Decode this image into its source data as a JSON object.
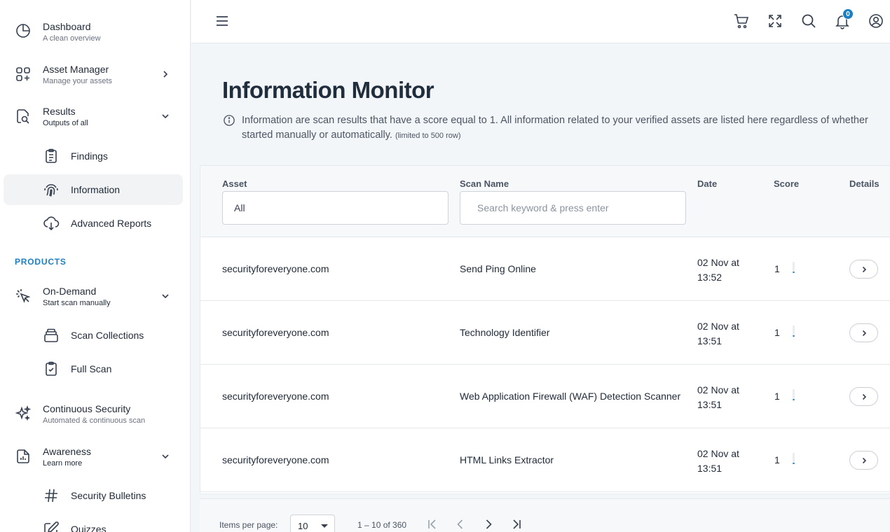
{
  "sidebar": {
    "dashboard": {
      "title": "Dashboard",
      "subtitle": "A clean overview"
    },
    "asset_manager": {
      "title": "Asset Manager",
      "subtitle": "Manage your assets"
    },
    "results": {
      "title": "Results",
      "subtitle": "Outputs of all"
    },
    "results_items": [
      {
        "label": "Findings"
      },
      {
        "label": "Information"
      },
      {
        "label": "Advanced Reports"
      }
    ],
    "products_label": "PRODUCTS",
    "on_demand": {
      "title": "On-Demand",
      "subtitle": "Start scan manually"
    },
    "on_demand_items": [
      {
        "label": "Scan Collections"
      },
      {
        "label": "Full Scan"
      }
    ],
    "continuous": {
      "title": "Continuous Security",
      "subtitle": "Automated & continuous scan"
    },
    "awareness": {
      "title": "Awareness",
      "subtitle": "Learn more"
    },
    "awareness_items": [
      {
        "label": "Security Bulletins"
      },
      {
        "label": "Quizzes"
      }
    ]
  },
  "topbar": {
    "notification_count": "0",
    "icons": [
      "menu-icon",
      "cart-icon",
      "fullscreen-icon",
      "search-icon",
      "bell-icon",
      "user-icon"
    ]
  },
  "main": {
    "title": "Information Monitor",
    "info_text": "Information are scan results that have a score equal to 1. All information related to your verified assets are listed here regardless of whether started manually or automatically.",
    "info_note": "(limited to 500 row)"
  },
  "table": {
    "columns": {
      "asset": "Asset",
      "scan_name": "Scan Name",
      "date": "Date",
      "score": "Score",
      "details": "Details"
    },
    "asset_filter_value": "All",
    "scan_search_placeholder": "Search keyword & press enter",
    "rows": [
      {
        "asset": "securityforeveryone.com",
        "scan_name": "Send Ping Online",
        "date_line1": "02 Nov at",
        "date_line2": "13:52",
        "score": "1",
        "score_fraction": 0.1
      },
      {
        "asset": "securityforeveryone.com",
        "scan_name": "Technology Identifier",
        "date_line1": "02 Nov at",
        "date_line2": "13:51",
        "score": "1",
        "score_fraction": 0.1
      },
      {
        "asset": "securityforeveryone.com",
        "scan_name": "Web Application Firewall (WAF) Detection Scanner",
        "date_line1": "02 Nov at",
        "date_line2": "13:51",
        "score": "1",
        "score_fraction": 0.1
      },
      {
        "asset": "securityforeveryone.com",
        "scan_name": "HTML Links Extractor",
        "date_line1": "02 Nov at",
        "date_line2": "13:51",
        "score": "1",
        "score_fraction": 0.1
      }
    ]
  },
  "pagination": {
    "items_per_page_label": "Items per page:",
    "items_per_page_value": "10",
    "range": "1 – 10 of 360"
  },
  "colors": {
    "accent": "#1b7fc4",
    "score_bar": "#2b8fd6"
  }
}
